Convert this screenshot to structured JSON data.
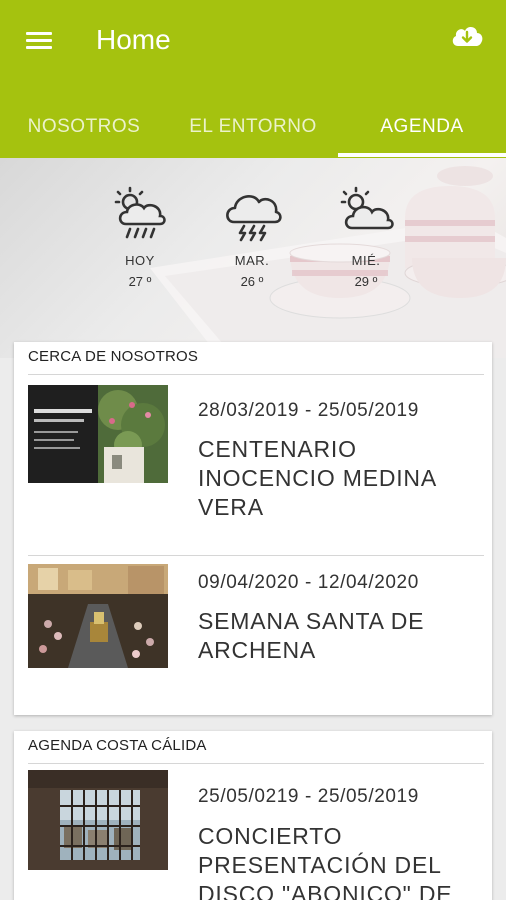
{
  "app": {
    "title": "Home"
  },
  "icons": {
    "menu": "hamburger-menu-icon",
    "download": "cloud-download-icon"
  },
  "colors": {
    "primary": "#a5c20f"
  },
  "tabs": [
    {
      "label": "NOSOTROS",
      "active": false
    },
    {
      "label": "EL ENTORNO",
      "active": false
    },
    {
      "label": "AGENDA",
      "active": true
    }
  ],
  "weather": [
    {
      "day": "HOY",
      "temp": "27 º",
      "icon": "sun-cloud-rain-icon"
    },
    {
      "day": "MAR.",
      "temp": "26 º",
      "icon": "cloud-thunderstorm-icon"
    },
    {
      "day": "MIÉ.",
      "temp": "29 º",
      "icon": "sun-cloud-icon"
    }
  ],
  "sections": [
    {
      "title": "CERCA DE NOSOTROS",
      "events": [
        {
          "dates": "28/03/2019 - 25/05/2019",
          "title": "CENTENARIO INOCENCIO MEDINA VERA",
          "poster_text": [
            "CENTENARIO",
            "Inocencio Medina Vera"
          ]
        },
        {
          "dates": "09/04/2020 - 12/04/2020",
          "title": "SEMANA SANTA DE ARCHENA"
        }
      ]
    },
    {
      "title": "AGENDA COSTA CÁLIDA",
      "events": [
        {
          "dates": "25/05/0219 - 25/05/2019",
          "title": "CONCIERTO PRESENTACIÓN DEL DISCO \"ABONICO\" DE"
        }
      ]
    }
  ]
}
